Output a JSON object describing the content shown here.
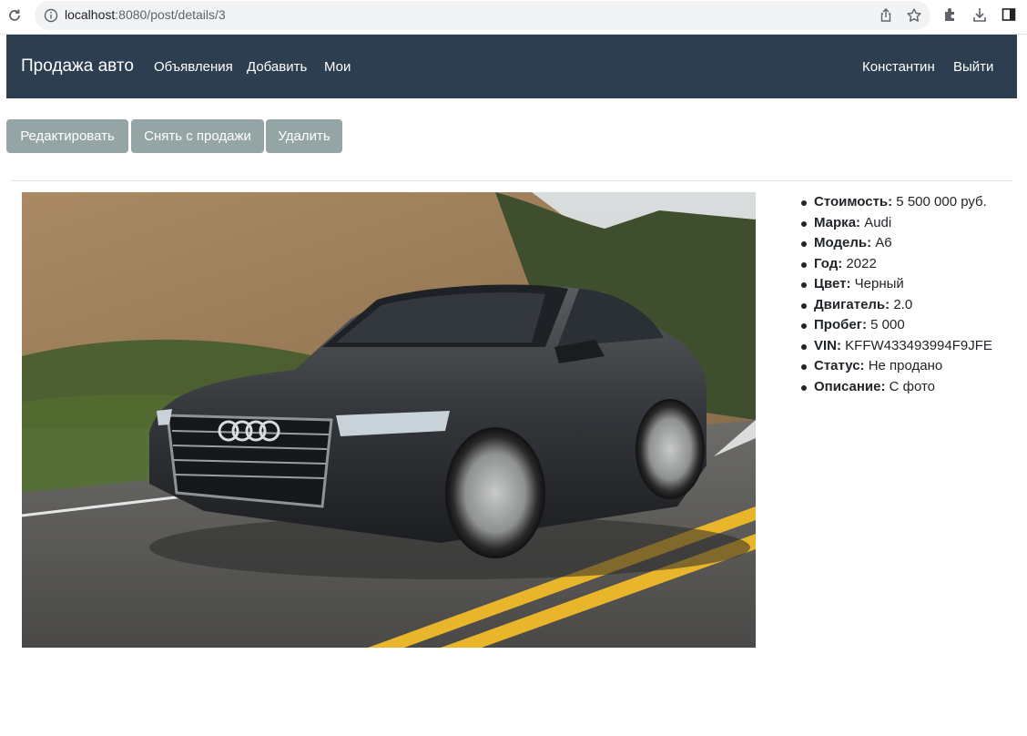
{
  "browser": {
    "url_host": "localhost",
    "url_path": ":8080/post/details/3"
  },
  "navbar": {
    "brand": "Продажа авто",
    "links": [
      "Объявления",
      "Добавить",
      "Мои"
    ],
    "user": "Константин",
    "logout": "Выйти",
    "bg_color": "#2c3e50"
  },
  "actions": {
    "edit": "Редактировать",
    "unpublish": "Снять с продажи",
    "delete": "Удалить",
    "button_color": "#95a5a6"
  },
  "car": {
    "photo_icon": "car-photo",
    "details": [
      {
        "label": "Стоимость:",
        "value": " 5 500 000 руб."
      },
      {
        "label": "Марка:",
        "value": " Audi"
      },
      {
        "label": "Модель:",
        "value": " A6"
      },
      {
        "label": "Год:",
        "value": " 2022"
      },
      {
        "label": "Цвет:",
        "value": " Черный"
      },
      {
        "label": "Двигатель:",
        "value": " 2.0"
      },
      {
        "label": "Пробег:",
        "value": " 5 000"
      },
      {
        "label": "VIN:",
        "value": " KFFW433493994F9JFE"
      },
      {
        "label": "Статус:",
        "value": " Не продано"
      },
      {
        "label": "Описание:",
        "value": " С фото"
      }
    ]
  }
}
